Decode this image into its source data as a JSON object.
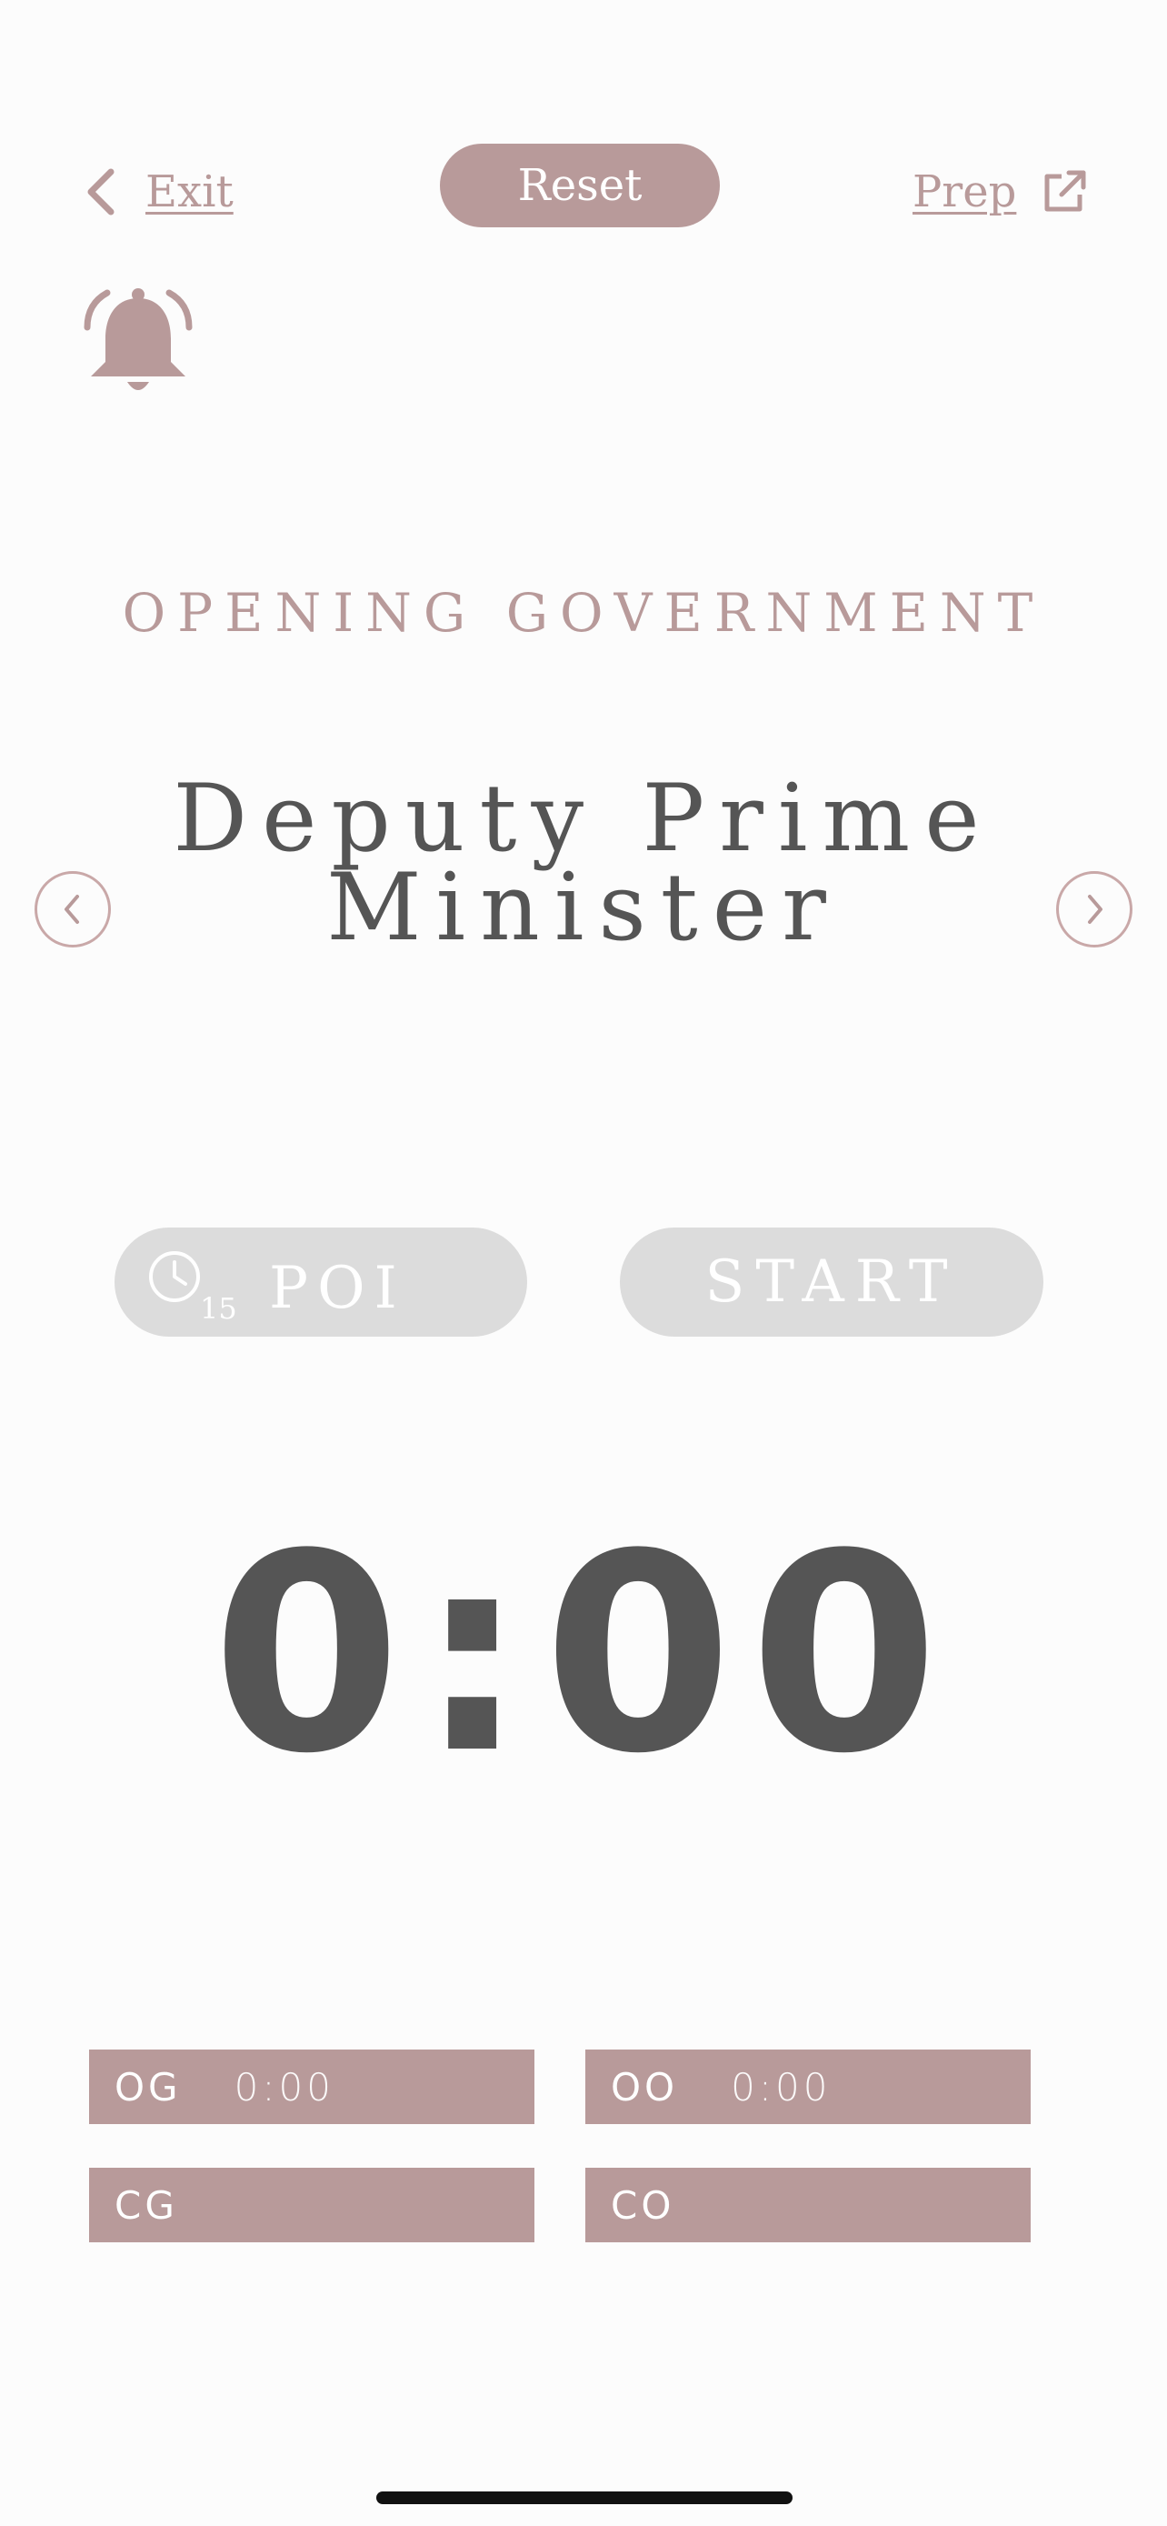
{
  "header": {
    "exit_label": "Exit",
    "reset_label": "Reset",
    "prep_label": "Prep"
  },
  "speaker": {
    "team": "OPENING GOVERNMENT",
    "role_line1": "Deputy Prime",
    "role_line2": "Minister"
  },
  "controls": {
    "poi_label": "POI",
    "poi_seconds": "15",
    "start_label": "START"
  },
  "timer": {
    "display": "0:00"
  },
  "teams": [
    {
      "code": "OG",
      "time": "0:00"
    },
    {
      "code": "OO",
      "time": "0:00"
    },
    {
      "code": "CG",
      "time": ""
    },
    {
      "code": "CO",
      "time": ""
    }
  ],
  "colors": {
    "accent": "#b89a9a",
    "text_dark": "#555555",
    "pill_disabled": "#dcdcdc"
  },
  "icons": [
    "chevron-left-icon",
    "external-link-icon",
    "bell-ringing-icon",
    "clock-icon",
    "chevron-right-icon"
  ]
}
